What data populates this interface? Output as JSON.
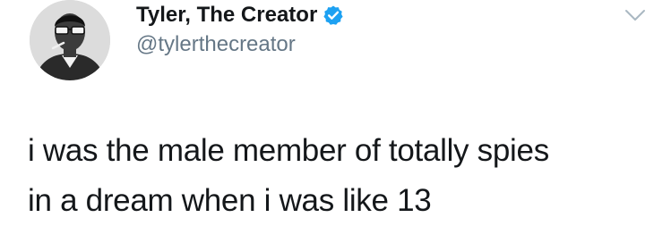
{
  "author": {
    "display_name": "Tyler, The Creator",
    "handle": "@tylerthecreator",
    "verified": true,
    "avatar": "profile-photo"
  },
  "tweet": {
    "text_lines": [
      "i was the male member of totally spies",
      "in a dream when i was like 13"
    ]
  },
  "icons": {
    "verified": "verified-badge-icon",
    "menu": "chevron-down-icon"
  },
  "colors": {
    "text": "#14171a",
    "handle": "#657786",
    "verified_badge": "#1da1f2",
    "caret": "#aab8c2"
  }
}
